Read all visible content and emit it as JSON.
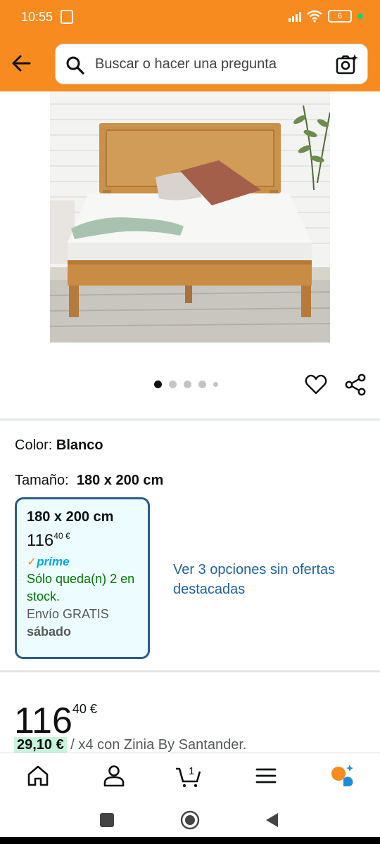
{
  "status": {
    "time": "10:55",
    "battery": "6"
  },
  "search": {
    "placeholder": "Buscar o hacer una pregunta"
  },
  "carousel": {
    "pages": 5,
    "active": 1
  },
  "color": {
    "label": "Color:",
    "value": "Blanco"
  },
  "size": {
    "label": "Tamaño:",
    "value": "180 x 200 cm"
  },
  "option": {
    "size": "180 x 200 cm",
    "price_whole": "116",
    "price_fraction": "40 €",
    "prime": "prime",
    "stock": "Sólo queda(n) 2 en stock.",
    "shipping": "Envío GRATIS",
    "delivery_day": "sábado"
  },
  "more_options": "Ver 3 opciones sin ofertas destacadas",
  "price": {
    "whole": "116",
    "fraction": "40 €"
  },
  "financing": {
    "amount": "29,10 €",
    "text": "/ x4 con Zinia By Santander."
  },
  "nav": {
    "cart_count": "1"
  },
  "colors": {
    "header": "#f78b1f",
    "link": "#2162a1",
    "stock": "#007600",
    "card_border": "#2d5c8a"
  }
}
